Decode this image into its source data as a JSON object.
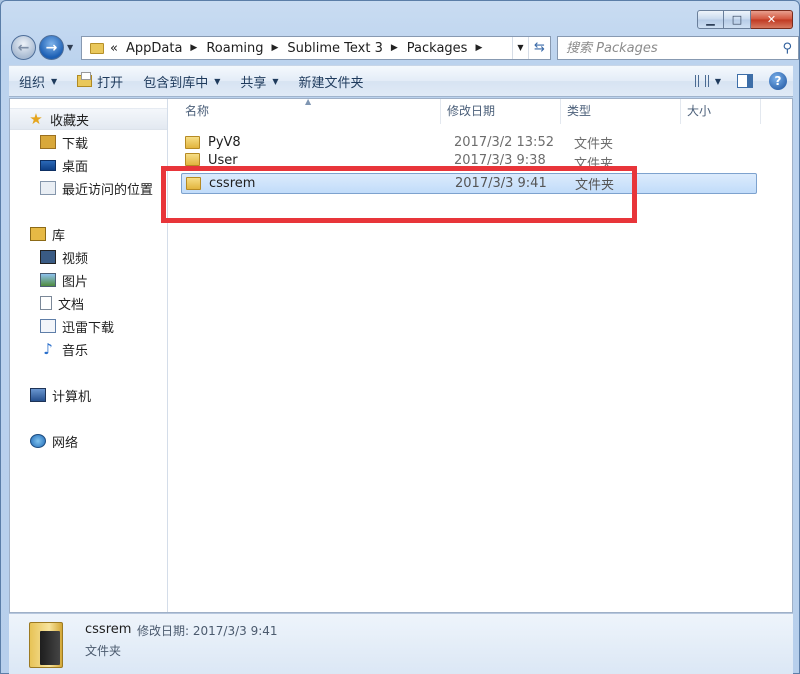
{
  "window": {
    "minimize": "▁",
    "maximize": "□",
    "close": "✕"
  },
  "nav": {
    "back": "←",
    "forward": "→",
    "breadcrumb": [
      "AppData",
      "Roaming",
      "Sublime Text 3",
      "Packages"
    ],
    "overflow": "«",
    "search_placeholder": "搜索 Packages"
  },
  "toolbar": {
    "organize": "组织",
    "open": "打开",
    "include_library": "包含到库中",
    "share": "共享",
    "new_folder": "新建文件夹",
    "help": "?"
  },
  "sidebar": {
    "favorites": "收藏夹",
    "downloads": "下载",
    "desktop": "桌面",
    "recent": "最近访问的位置",
    "libraries": "库",
    "videos": "视频",
    "pictures": "图片",
    "documents": "文档",
    "xunlei": "迅雷下载",
    "music": "音乐",
    "computer": "计算机",
    "network": "网络"
  },
  "columns": {
    "name": "名称",
    "date": "修改日期",
    "type": "类型",
    "size": "大小"
  },
  "files": [
    {
      "name": "PyV8",
      "date": "2017/3/2 13:52",
      "type": "文件夹"
    },
    {
      "name": "User",
      "date": "2017/3/3 9:38",
      "type": "文件夹"
    },
    {
      "name": "cssrem",
      "date": "2017/3/3 9:41",
      "type": "文件夹"
    }
  ],
  "details": {
    "name": "cssrem",
    "meta": "修改日期: 2017/3/3 9:41",
    "type": "文件夹"
  },
  "colors": {
    "highlight": "#e8353a",
    "selection": "#c1dcfa"
  }
}
